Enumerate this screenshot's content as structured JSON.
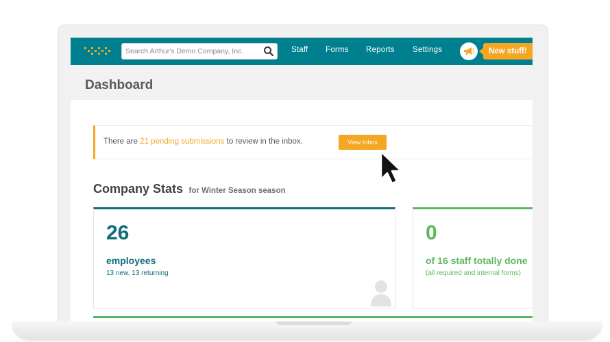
{
  "navbar": {
    "search_placeholder": "Search Arthur's Demo Company, Inc.",
    "links": [
      "Staff",
      "Forms",
      "Reports",
      "Settings"
    ],
    "new_stuff_label": "New stuff!"
  },
  "page": {
    "title": "Dashboard"
  },
  "alert": {
    "prefix": "There are ",
    "link_text": "21 pending submissions",
    "suffix": " to review in the inbox.",
    "button_label": "View Inbox"
  },
  "stats": {
    "title": "Company Stats",
    "subtitle": "for Winter Season season",
    "cards": [
      {
        "number": "26",
        "label": "employees",
        "sub": "13 new, 13 returning"
      },
      {
        "number": "0",
        "label": "of 16 staff totally done",
        "sub": "(all required and internal forms)"
      }
    ]
  },
  "colors": {
    "navbar": "#00808e",
    "accent_orange": "#f5a623",
    "teal_dark": "#0d6d78",
    "green": "#5cb85c"
  },
  "icons": [
    "logo-icon",
    "search-icon",
    "megaphone-icon",
    "user-placeholder-icon",
    "mouse-cursor-icon"
  ]
}
